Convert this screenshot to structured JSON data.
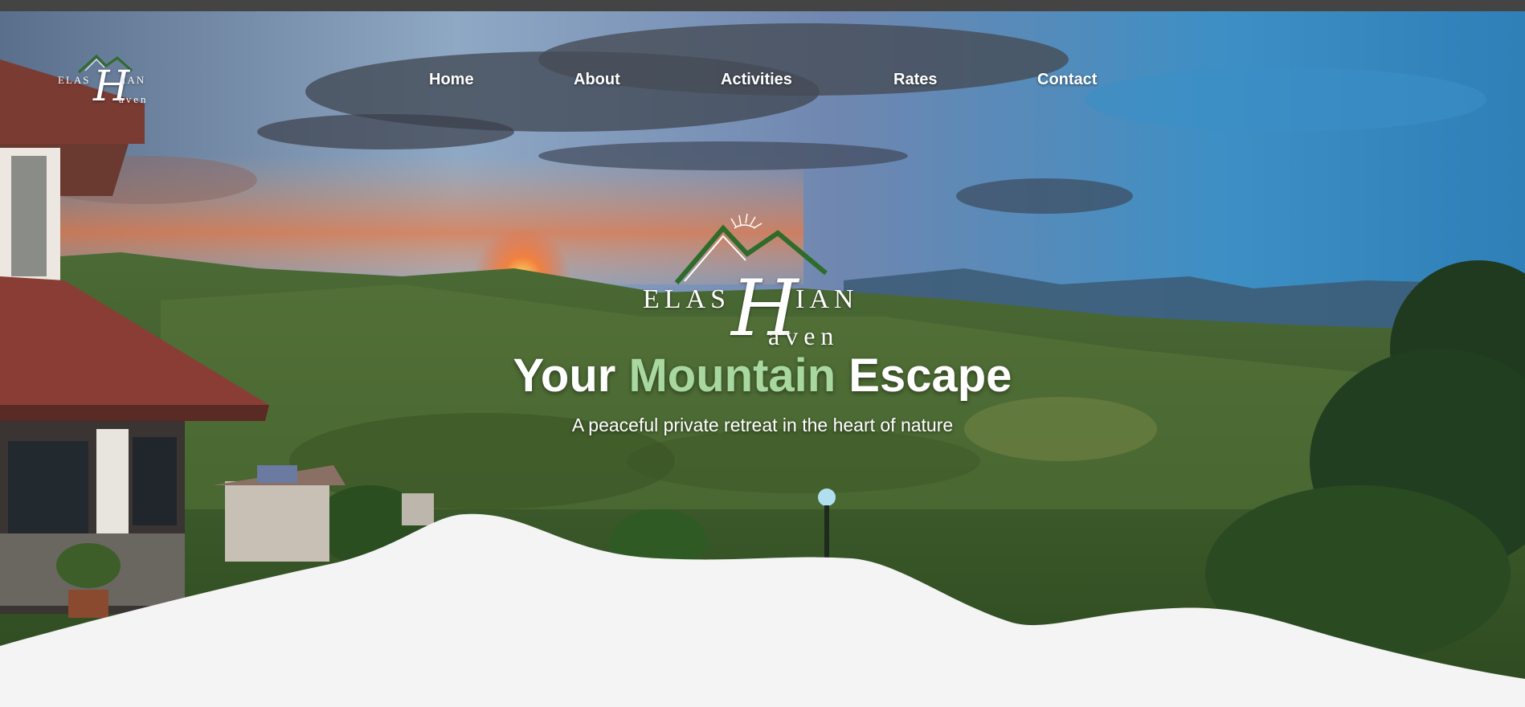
{
  "nav": {
    "items": [
      "Home",
      "About",
      "Activities",
      "Rates",
      "Contact"
    ]
  },
  "brand": {
    "line1_left": "ELAS",
    "line1_right": "IAN",
    "big_letter_top": "H",
    "big_letter_bottom": "H",
    "line2": "aven"
  },
  "hero": {
    "headline_pre": "Your ",
    "headline_accent": "Mountain",
    "headline_post": " Escape",
    "tagline": "A peaceful private retreat in the heart of nature"
  },
  "colors": {
    "accent_green": "#a8d8a0",
    "wave_fill": "#f4f4f4",
    "topbar": "#444444"
  }
}
